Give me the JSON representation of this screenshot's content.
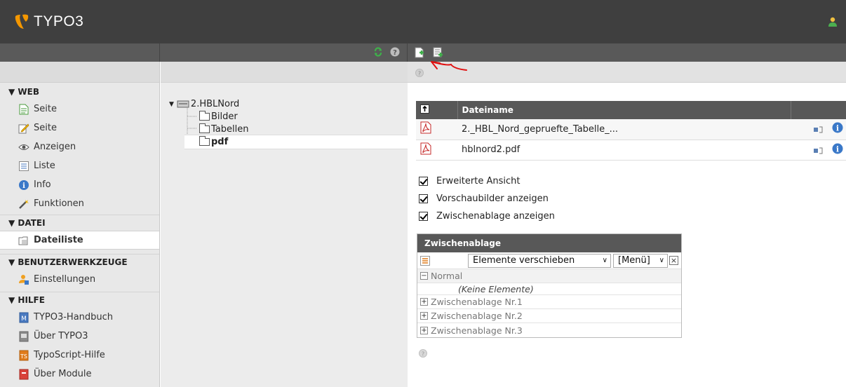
{
  "header": {
    "logo_text": "TYPO3"
  },
  "module_menu": {
    "groups": [
      {
        "title": "▼ WEB",
        "items": [
          {
            "label": "Seite",
            "icon": "page-icon"
          },
          {
            "label": "Seite",
            "icon": "edit-page-icon"
          },
          {
            "label": "Anzeigen",
            "icon": "eye-icon"
          },
          {
            "label": "Liste",
            "icon": "list-icon"
          },
          {
            "label": "Info",
            "icon": "info-icon"
          },
          {
            "label": "Funktionen",
            "icon": "wand-icon"
          }
        ]
      },
      {
        "title": "▼ DATEI",
        "items": [
          {
            "label": "Dateiliste",
            "icon": "filelist-icon",
            "active": true
          }
        ]
      },
      {
        "title": "▼ BENUTZERWERKZEUGE",
        "items": [
          {
            "label": "Einstellungen",
            "icon": "user-settings-icon"
          }
        ]
      },
      {
        "title": "▼ HILFE",
        "items": [
          {
            "label": "TYPO3-Handbuch",
            "icon": "manual-icon"
          },
          {
            "label": "Über TYPO3",
            "icon": "about-icon"
          },
          {
            "label": "TypoScript-Hilfe",
            "icon": "typoscript-icon"
          },
          {
            "label": "Über Module",
            "icon": "about-modules-icon"
          }
        ]
      }
    ]
  },
  "tree": {
    "root": "2.HBLNord",
    "folders": [
      "Bilder",
      "Tabellen",
      "pdf"
    ],
    "selected": "pdf"
  },
  "file_table": {
    "header_name": "Dateiname",
    "rows": [
      {
        "name": "2._HBL_Nord_gepruefte_Tabelle_..."
      },
      {
        "name": "hblnord2.pdf"
      }
    ]
  },
  "options": {
    "extended_view": "Erweiterte Ansicht",
    "thumbnails": "Vorschaubilder anzeigen",
    "clipboard": "Zwischenablage anzeigen"
  },
  "clipboard": {
    "title": "Zwischenablage",
    "mode_select": "Elemente verschieben",
    "menu_select": "[Menü]",
    "normal_label": "Normal",
    "no_elements": "(Keine Elemente)",
    "pads": [
      "Zwischenablage Nr.1",
      "Zwischenablage Nr.2",
      "Zwischenablage Nr.3"
    ]
  },
  "colors": {
    "topbar": "#3f3f3f",
    "logo_orange": "#f49700",
    "annotation_red": "#e01010"
  }
}
